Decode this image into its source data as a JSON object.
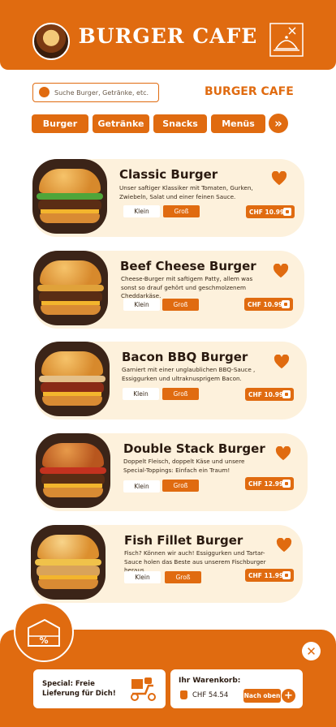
{
  "header": {
    "title": "BURGER CAFE"
  },
  "search": {
    "placeholder": "Suche Burger, Getränke, etc."
  },
  "section_title": "BURGER CAFE",
  "categories": [
    "Burger",
    "Getränke",
    "Snacks",
    "Menüs"
  ],
  "items": [
    {
      "name": "Classic Burger",
      "desc": "Unser saftiger Klassiker mit Tomaten, Gurken, Zwiebeln, Salat und einer feinen Sauce.",
      "size_small": "Klein",
      "size_large": "Groß",
      "price": "CHF 10.99"
    },
    {
      "name": "Beef Cheese Burger",
      "desc": "Cheese-Burger mit saftigem Patty, allem was sonst so drauf gehört und geschmolzenem Cheddarkäse.",
      "size_small": "Klein",
      "size_large": "Groß",
      "price": "CHF 10.99"
    },
    {
      "name": "Bacon BBQ Burger",
      "desc": "Garniert mit einer unglaublichen BBQ-Sauce , Essiggurken und ultraknusprigem Bacon.",
      "size_small": "Klein",
      "size_large": "Groß",
      "price": "CHF 10.99"
    },
    {
      "name": "Double Stack Burger",
      "desc": "Doppelt Fleisch, doppelt Käse und unsere Special-Toppings: Einfach ein Traum!",
      "size_small": "Klein",
      "size_large": "Groß",
      "price": "CHF 12.99"
    },
    {
      "name": "Fish Fillet Burger",
      "desc": "Fisch? Können wir auch! Essiggurken und Tartar-Sauce holen das Beste aus unserem Fischburger heraus..",
      "size_small": "Klein",
      "size_large": "Groß",
      "price": "CHF 11.99"
    }
  ],
  "promo": {
    "text": "Special: Freie Lieferung für Dich!"
  },
  "cart": {
    "label": "Ihr Warenkorb:",
    "total": "CHF 54.54",
    "go_top": "Nach oben"
  },
  "colors": {
    "accent": "#e06b10",
    "card_bg": "#fdf1dc"
  },
  "icons": [
    "burger-logo-icon",
    "cloche-icon",
    "search-icon",
    "chevrons-right-icon",
    "heart-icon",
    "cart-icon",
    "percent-badge-icon",
    "close-icon",
    "delivery-scooter-icon",
    "bag-icon",
    "plus-icon"
  ]
}
